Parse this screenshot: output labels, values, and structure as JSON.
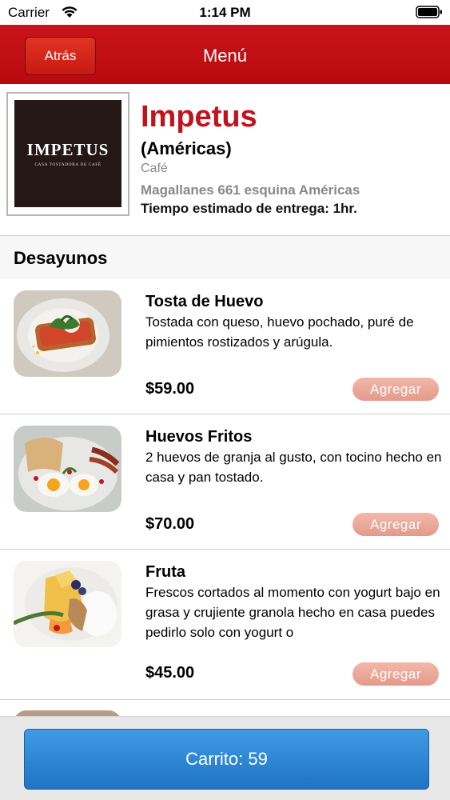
{
  "status_bar": {
    "carrier": "Carrier",
    "time": "1:14 PM"
  },
  "nav": {
    "back_label": "Atrás",
    "title": "Menú"
  },
  "restaurant": {
    "logo_text": "IMPETUS",
    "logo_subtext": "CASA TOSTADORA DE CAFÉ",
    "name": "Impetus",
    "branch": "(Américas)",
    "type": "Café",
    "address": "Magallanes 661 esquina Américas",
    "delivery": "Tiempo estimado de entrega: 1hr."
  },
  "section": {
    "title": "Desayunos"
  },
  "items": [
    {
      "name": "Tosta de Huevo",
      "description": "Tostada con queso, huevo pochado, puré de pimientos rostizados y arúgula.",
      "price": "$59.00",
      "add_label": "Agregar"
    },
    {
      "name": "Huevos Fritos",
      "description": "2 huevos de granja al gusto, con tocino hecho en casa y pan tostado.",
      "price": "$70.00",
      "add_label": "Agregar"
    },
    {
      "name": "Fruta",
      "description": "Frescos cortados al momento con yogurt bajo en grasa y crujiente granola hecho en casa puedes pedirlo solo con yogurt o",
      "price": "$45.00",
      "add_label": "Agregar"
    }
  ],
  "cart": {
    "label": "Carrito: 59"
  },
  "colors": {
    "brand_red": "#c40c12",
    "cart_blue": "#2e88d6",
    "add_button": "#e9a797"
  }
}
